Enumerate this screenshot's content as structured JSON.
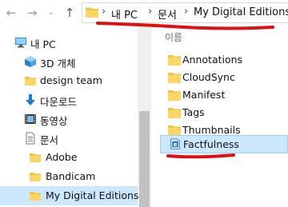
{
  "toolbar": {
    "back_icon": "left-arrow-icon",
    "forward_icon": "right-arrow-icon",
    "recent_icon": "chevron-down-icon",
    "up_icon": "up-arrow-icon"
  },
  "address_bar": {
    "crumbs": [
      "내 PC",
      "문서",
      "My Digital Editions"
    ],
    "separator": "›"
  },
  "sidebar": {
    "items": [
      {
        "label": "내 PC",
        "icon": "computer-icon"
      },
      {
        "label": "3D 개체",
        "icon": "3d-objects-icon"
      },
      {
        "label": "design team",
        "icon": "folder-icon"
      },
      {
        "label": "다운로드",
        "icon": "download-icon"
      },
      {
        "label": "동영상",
        "icon": "video-icon"
      },
      {
        "label": "문서",
        "icon": "documents-icon"
      },
      {
        "label": "Adobe",
        "icon": "folder-icon"
      },
      {
        "label": "Bandicam",
        "icon": "folder-icon"
      },
      {
        "label": "My Digital Editions",
        "icon": "folder-icon",
        "selected": true
      }
    ]
  },
  "file_list": {
    "column_name": "이름",
    "items": [
      {
        "name": "Annotations",
        "icon": "folder-icon"
      },
      {
        "name": "CloudSync",
        "icon": "folder-icon"
      },
      {
        "name": "Manifest",
        "icon": "folder-icon"
      },
      {
        "name": "Tags",
        "icon": "folder-icon"
      },
      {
        "name": "Thumbnails",
        "icon": "folder-icon"
      },
      {
        "name": "Factfulness",
        "icon": "ebook-file-icon",
        "selected": true
      }
    ]
  },
  "colors": {
    "selection": "#cce8ff",
    "selection_border": "#99d1ff",
    "folder": "#f5c342",
    "annotation": "#e01010"
  }
}
